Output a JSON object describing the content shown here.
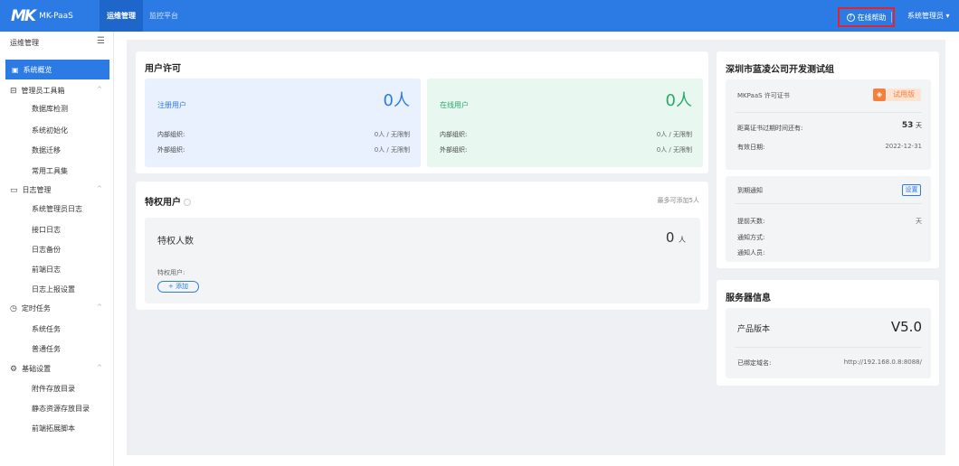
{
  "topbar": {
    "logo_mark": "MK",
    "logo_text": "MK-PaaS",
    "nav": [
      "运维管理",
      "监控平台"
    ],
    "help_label": "在线帮助",
    "help_icon": "question-circle-icon",
    "user_label": "系统管理员 ▾"
  },
  "sidebar": {
    "header": "运维管理",
    "active_item": "系统概览",
    "groups": [
      {
        "label": "管理员工具箱",
        "items": [
          "数据库检测",
          "系统初始化",
          "数据迁移",
          "常用工具集"
        ]
      },
      {
        "label": "日志管理",
        "items": [
          "系统管理员日志",
          "接口日志",
          "日志备份",
          "前端日志",
          "日志上报设置"
        ]
      },
      {
        "label": "定时任务",
        "items": [
          "系统任务",
          "普通任务"
        ]
      },
      {
        "label": "基础设置",
        "items": [
          "附件存放目录",
          "静态资源存放目录",
          "前端拓展脚本"
        ]
      }
    ]
  },
  "license": {
    "title": "用户许可",
    "registered": {
      "label": "注册用户",
      "count": "0人",
      "internal_label": "内部组织:",
      "internal_value": "0人 / 无限制",
      "external_label": "外部组织:",
      "external_value": "0人 / 无限制"
    },
    "online": {
      "label": "在线用户",
      "count": "0人",
      "internal_label": "内部组织:",
      "internal_value": "0人 / 无限制",
      "external_label": "外部组织:",
      "external_value": "0人 / 无限制"
    }
  },
  "privileged": {
    "title": "特权用户",
    "hint": "最多可添加5人",
    "count_label": "特权人数",
    "count_value": "0",
    "count_unit": "人",
    "users_label": "特权用户:",
    "add_button": "+ 添加"
  },
  "org": {
    "title": "深圳市蓝凌公司开发测试组",
    "cert_label": "MKPaaS 许可证书",
    "trial_badge": "试用版",
    "expire_label": "距离证书过期时间还有:",
    "expire_value": "53",
    "expire_unit": "天",
    "valid_label": "有效日期:",
    "valid_value": "2022-12-31"
  },
  "notice": {
    "title": "到期通知",
    "settings_button": "设置",
    "advance_label": "提前天数:",
    "advance_value": "天",
    "method_label": "通知方式:",
    "people_label": "通知人员:"
  },
  "server": {
    "title": "服务器信息",
    "version_label": "产品版本",
    "version_value": "V5.0",
    "domain_label": "已绑定域名:",
    "domain_value": "http://192.168.0.8:8088/"
  }
}
